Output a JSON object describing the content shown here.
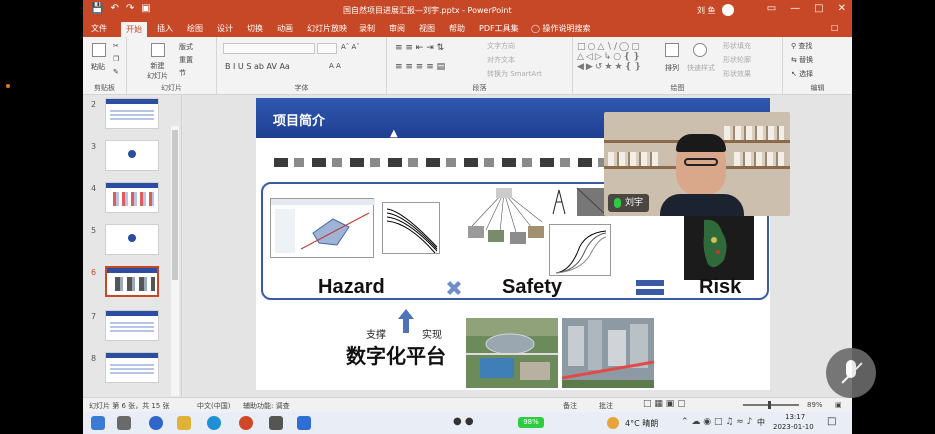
{
  "window": {
    "doc_title": "国自然项目进展汇报—刘宇.pptx  -  PowerPoint",
    "user_name": "刘 鱼",
    "qat_icons": [
      "save-icon",
      "undo-icon",
      "redo-icon",
      "present-icon"
    ]
  },
  "tabs": [
    "文件",
    "开始",
    "插入",
    "绘图",
    "设计",
    "切换",
    "动画",
    "幻灯片放映",
    "录制",
    "审阅",
    "视图",
    "帮助",
    "PDF工具集",
    "操作说明搜索"
  ],
  "active_tab": "开始",
  "ribbon": {
    "groups": [
      "剪贴板",
      "幻灯片",
      "字体",
      "段落",
      "绘图",
      "编辑"
    ],
    "clipboard": {
      "paste": "粘贴"
    },
    "slides": {
      "new_slide": "新建\n幻灯片",
      "layout": "版式",
      "reset": "重置",
      "section": "节"
    },
    "paragraph": {
      "text_direction": "文字方向",
      "align_text": "对齐文本",
      "smartart": "转换为 SmartArt"
    },
    "drawing": {
      "arrange": "排列",
      "quick_styles": "快速样式",
      "fill": "形状填充",
      "outline": "形状轮廓",
      "effects": "形状效果"
    },
    "editing": {
      "find": "查找",
      "replace": "替换",
      "select": "选择"
    }
  },
  "thumbnails": [
    {
      "num": "2",
      "kind": "table"
    },
    {
      "num": "3",
      "kind": "logo"
    },
    {
      "num": "4",
      "kind": "table"
    },
    {
      "num": "5",
      "kind": "logo"
    },
    {
      "num": "6",
      "kind": "content",
      "active": true
    },
    {
      "num": "7",
      "kind": "table"
    },
    {
      "num": "8",
      "kind": "table"
    }
  ],
  "slide": {
    "title": "项目简介",
    "hazard": "Hazard",
    "safety": "Safety",
    "risk": "Risk",
    "support": "支撑",
    "realize": "实现",
    "platform": "数字化平台"
  },
  "video": {
    "name": "刘宇"
  },
  "statusbar": {
    "slide_info": "幻灯片 第 6 张，共 15 张",
    "language": "中文(中国)",
    "accessibility": "辅助功能: 调查",
    "notes": "备注",
    "comments": "批注",
    "zoom": "89%"
  },
  "taskbar": {
    "weather": "4°C 晴朗",
    "battery": "98%",
    "ime": "中",
    "time": "13:17",
    "date": "2023-01-10"
  }
}
